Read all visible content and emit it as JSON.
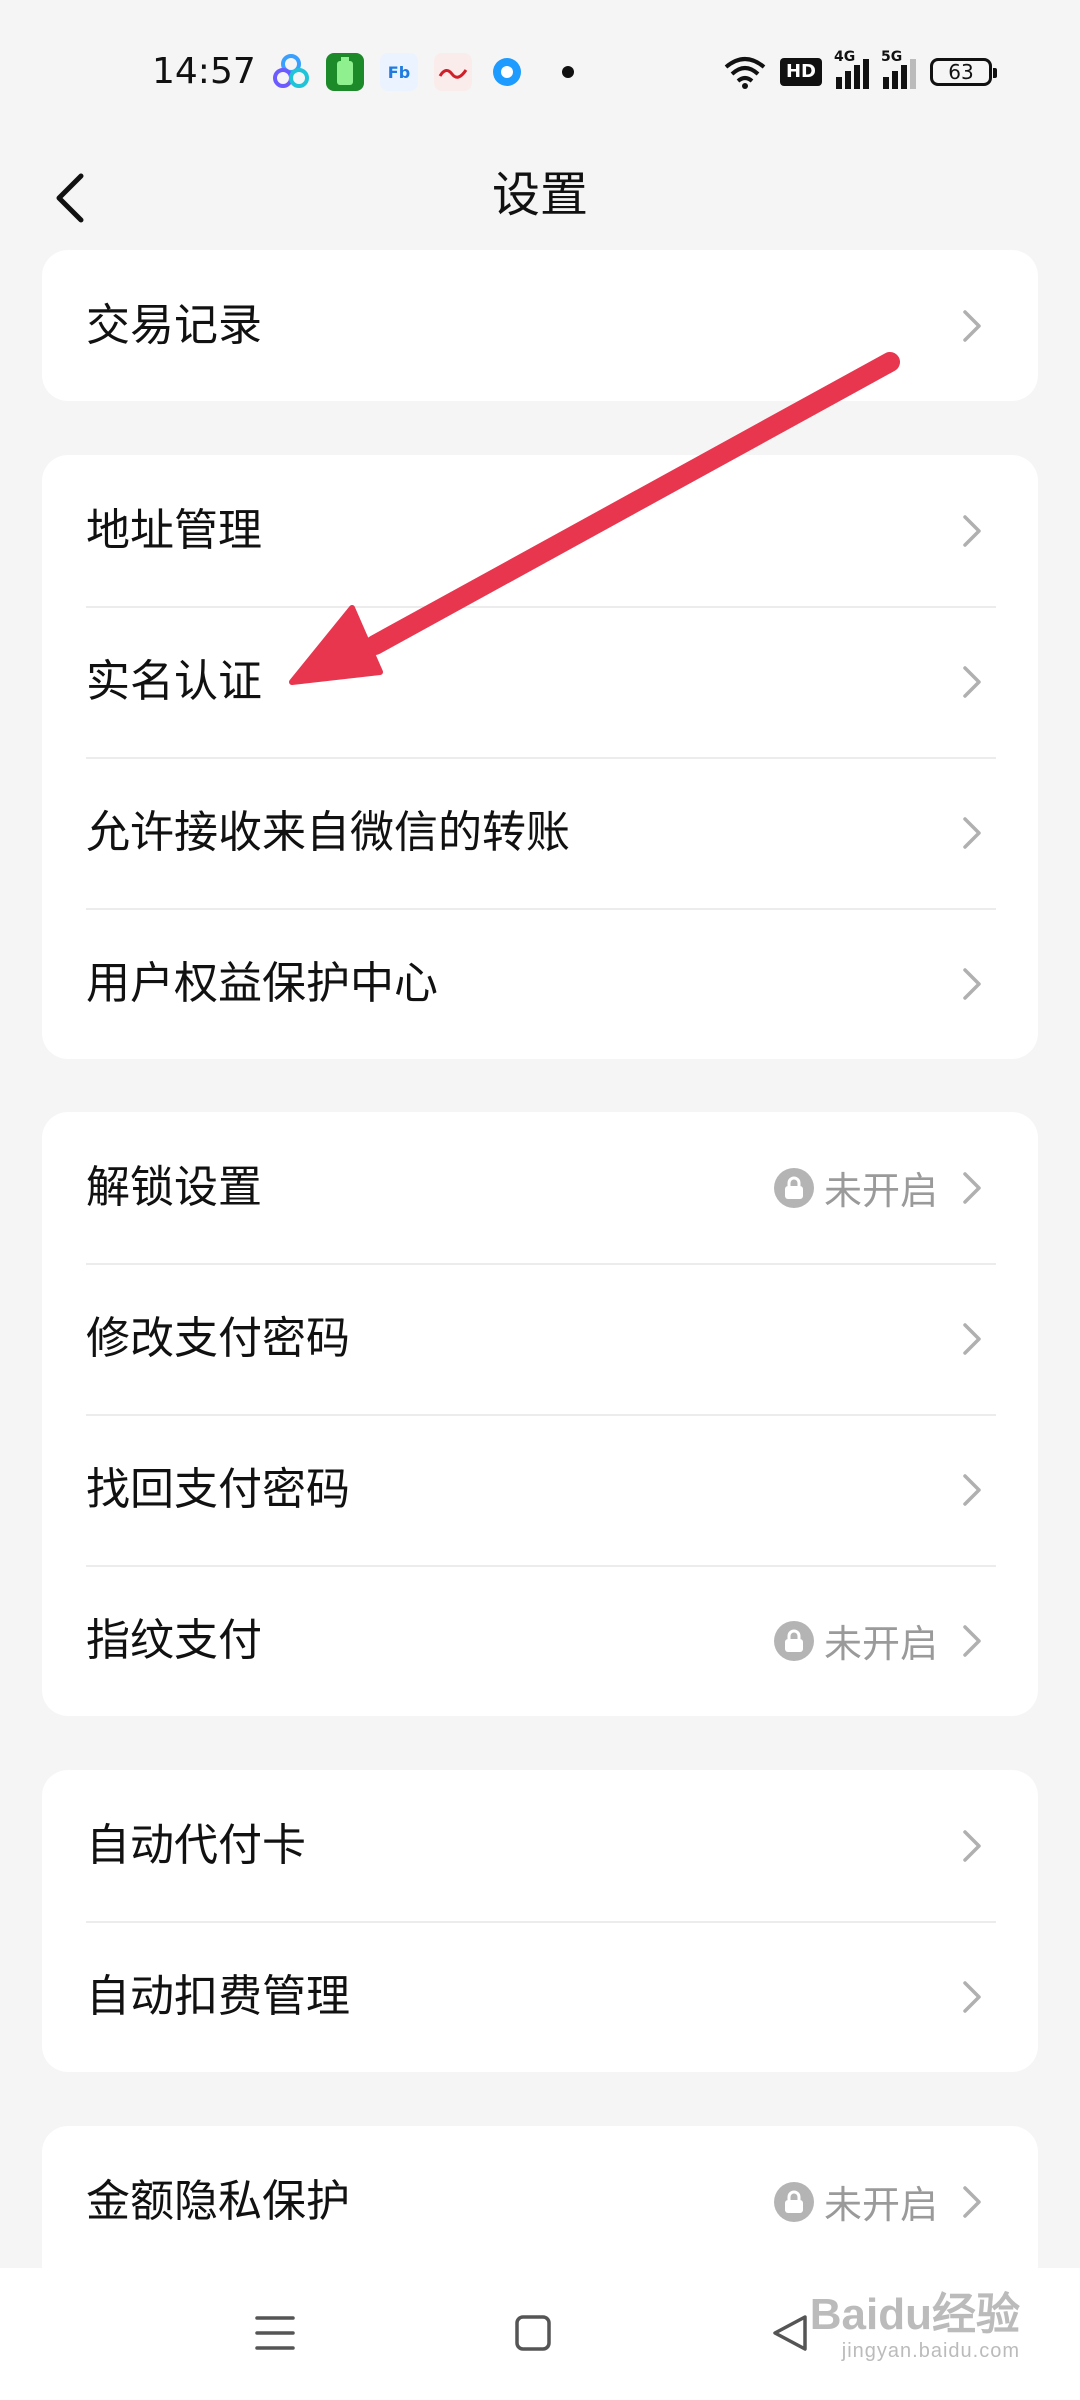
{
  "status_bar": {
    "time": "14:57",
    "hd_label": "HD",
    "net_4g": "4G",
    "net_5g": "5G",
    "battery": "63"
  },
  "header": {
    "title": "设置"
  },
  "groups": [
    {
      "rows": [
        {
          "label": "交易记录",
          "status": null
        }
      ]
    },
    {
      "rows": [
        {
          "label": "地址管理",
          "status": null
        },
        {
          "label": "实名认证",
          "status": null
        },
        {
          "label": "允许接收来自微信的转账",
          "status": null
        },
        {
          "label": "用户权益保护中心",
          "status": null
        }
      ]
    },
    {
      "rows": [
        {
          "label": "解锁设置",
          "status": "未开启"
        },
        {
          "label": "修改支付密码",
          "status": null
        },
        {
          "label": "找回支付密码",
          "status": null
        },
        {
          "label": "指纹支付",
          "status": "未开启"
        }
      ]
    },
    {
      "rows": [
        {
          "label": "自动代付卡",
          "status": null
        },
        {
          "label": "自动扣费管理",
          "status": null
        }
      ]
    },
    {
      "rows": [
        {
          "label": "金额隐私保护",
          "status": "未开启"
        }
      ]
    }
  ],
  "watermark": {
    "brand": "Baidu经验",
    "url": "jingyan.baidu.com"
  },
  "colors": {
    "arrow": "#e8364f",
    "background": "#f5f5f5",
    "card": "#ffffff"
  }
}
